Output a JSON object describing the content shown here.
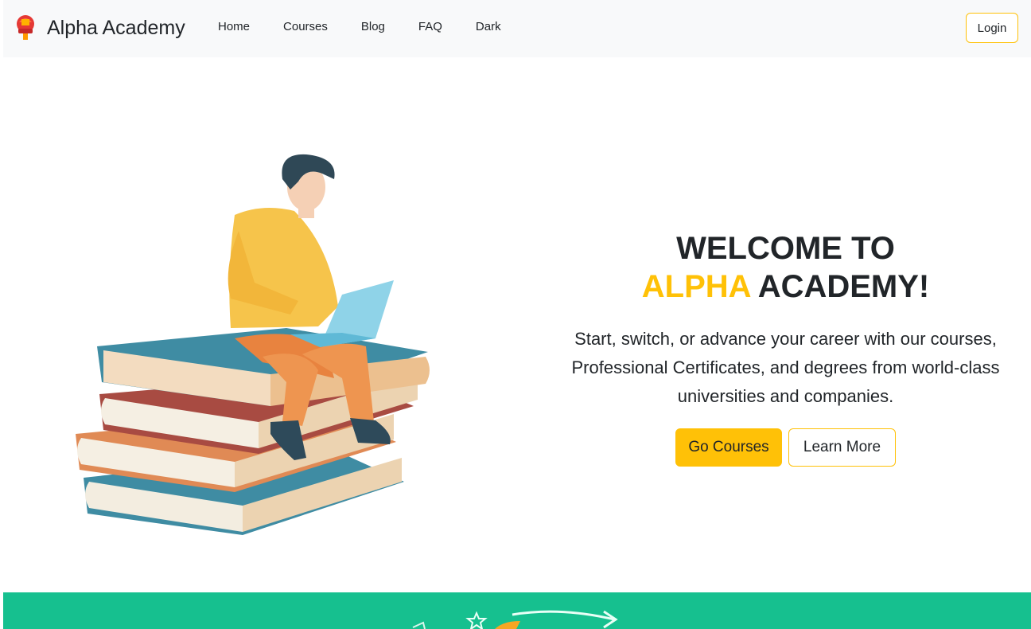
{
  "brand": {
    "name": "Alpha Academy",
    "logo_icon": "torch-logo-icon"
  },
  "nav": {
    "links": [
      {
        "label": "Home"
      },
      {
        "label": "Courses"
      },
      {
        "label": "Blog"
      },
      {
        "label": "FAQ"
      },
      {
        "label": "Dark"
      }
    ],
    "login_label": "Login"
  },
  "hero": {
    "title_line1": "WELCOME TO",
    "title_accent": "ALPHA",
    "title_rest": "ACADEMY!",
    "subtitle": "Start, switch, or advance your career with our courses, Professional Certificates, and degrees from world-class universities and companies.",
    "primary_button": "Go Courses",
    "secondary_button": "Learn More"
  },
  "colors": {
    "accent": "#ffc107",
    "navbar_bg": "#f8f9fa",
    "section_teal": "#16c08f",
    "text": "#212529"
  }
}
